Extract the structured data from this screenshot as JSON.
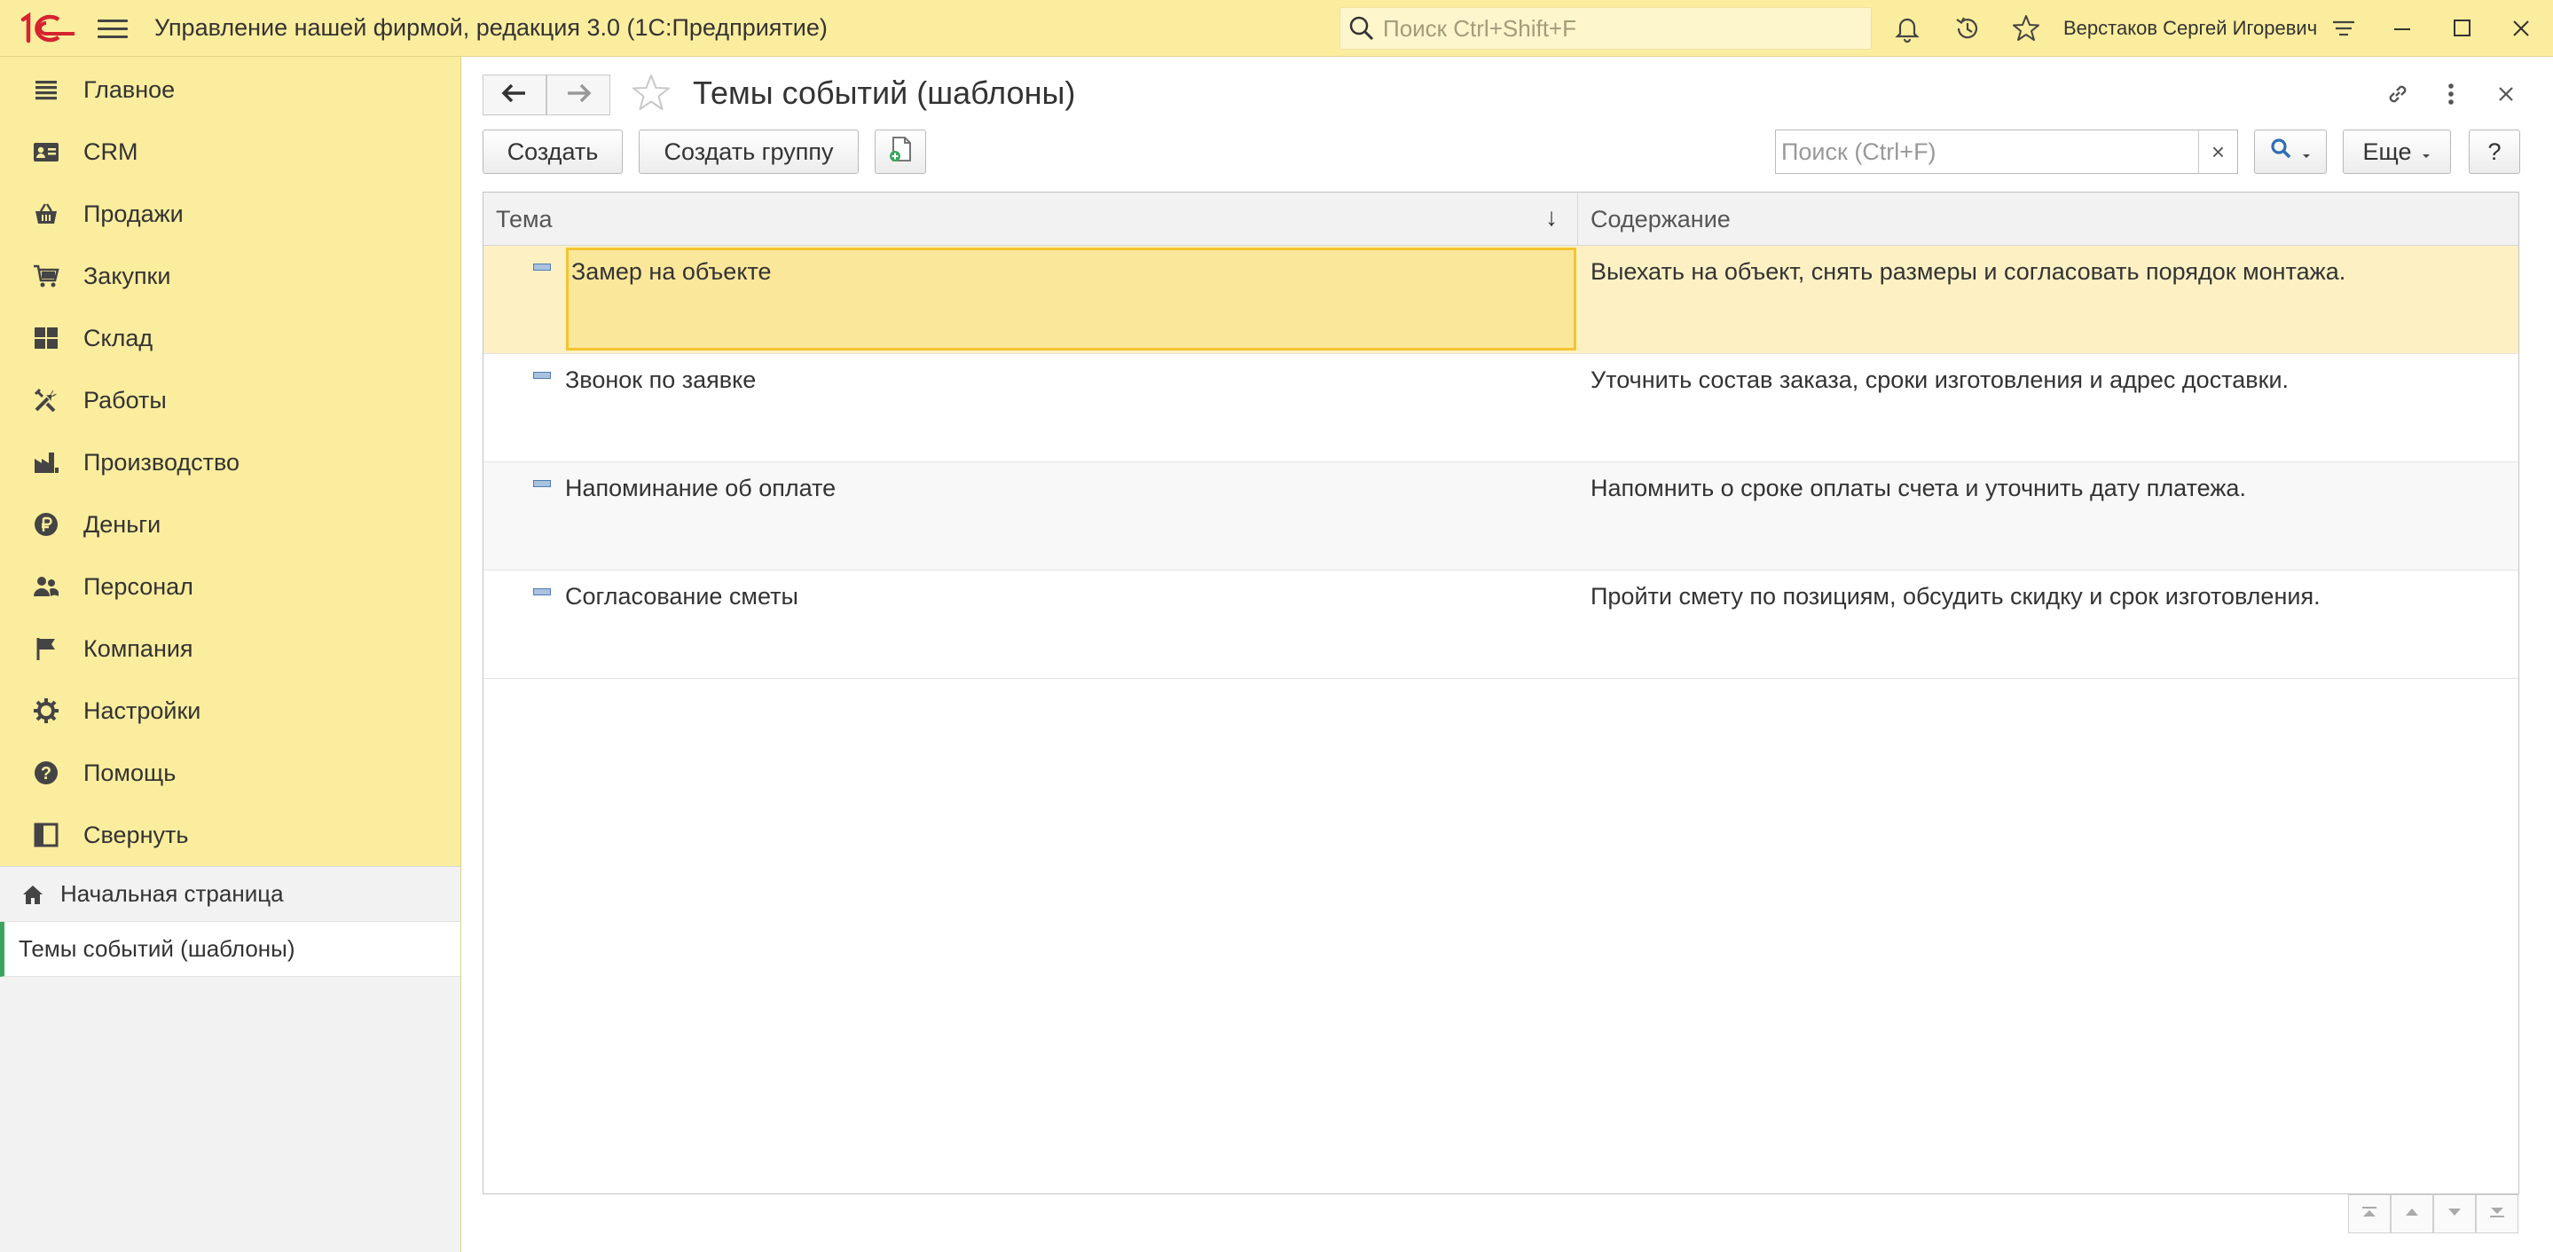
{
  "app": {
    "title": "Управление нашей фирмой, редакция 3.0  (1С:Предприятие)",
    "search_placeholder": "Поиск Ctrl+Shift+F",
    "user": "Верстаков Сергей Игоревич",
    "brand_color": "#fbed9e",
    "logo_color": "#d5232f"
  },
  "sidebar": {
    "items": [
      {
        "label": "Главное",
        "icon": "menu-lines-icon"
      },
      {
        "label": "CRM",
        "icon": "contact-card-icon"
      },
      {
        "label": "Продажи",
        "icon": "basket-icon"
      },
      {
        "label": "Закупки",
        "icon": "cart-icon"
      },
      {
        "label": "Склад",
        "icon": "grid-icon"
      },
      {
        "label": "Работы",
        "icon": "tools-icon"
      },
      {
        "label": "Производство",
        "icon": "factory-icon"
      },
      {
        "label": "Деньги",
        "icon": "ruble-icon"
      },
      {
        "label": "Персонал",
        "icon": "people-icon"
      },
      {
        "label": "Компания",
        "icon": "flag-icon"
      },
      {
        "label": "Настройки",
        "icon": "gear-icon"
      },
      {
        "label": "Помощь",
        "icon": "help-icon"
      },
      {
        "label": "Свернуть",
        "icon": "collapse-panel-icon"
      }
    ],
    "open_windows": {
      "home": "Начальная страница",
      "current": "Темы событий (шаблоны)"
    }
  },
  "main": {
    "title": "Темы событий (шаблоны)",
    "toolbar": {
      "create": "Создать",
      "create_group": "Создать группу",
      "search_placeholder": "Поиск (Ctrl+F)",
      "clear": "×",
      "more": "Еще",
      "help": "?"
    },
    "table": {
      "columns": [
        "Тема",
        "Содержание"
      ],
      "sort_indicator": "↓",
      "rows": [
        {
          "topic": "Замер на объекте",
          "content": "Выехать на объект, снять размеры и согласовать порядок монтажа."
        },
        {
          "topic": "Звонок по заявке",
          "content": "Уточнить состав заказа, сроки изготовления и адрес доставки."
        },
        {
          "topic": "Напоминание об оплате",
          "content": "Напомнить о сроке оплаты счета и уточнить дату платежа."
        },
        {
          "topic": "Согласование сметы",
          "content": "Пройти смету по позициям, обсудить скидку и срок изготовления."
        }
      ],
      "selected_row": 0
    }
  }
}
